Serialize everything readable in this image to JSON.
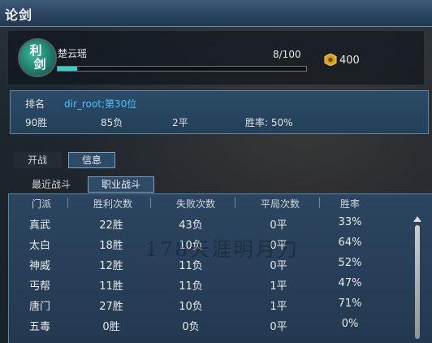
{
  "window": {
    "title": "论剑"
  },
  "player": {
    "emblem_top": "利",
    "emblem_bottom": "剑",
    "name": "楚云瑶",
    "progress_text": "8/100",
    "progress_fraction": 0.08,
    "currency": "400"
  },
  "stats": {
    "rank_label": "排名",
    "rank_value": "dir_root;第30位",
    "wins": "90胜",
    "losses": "85负",
    "draws": "2平",
    "win_rate": "胜率:  50%"
  },
  "tabs": {
    "main": [
      "开战",
      "信息"
    ],
    "sub": [
      "最近战斗",
      "职业战斗"
    ]
  },
  "table": {
    "headers": [
      "门派",
      "胜利次数",
      "失败次数",
      "平局次数",
      "胜率"
    ],
    "rows": [
      [
        "真武",
        "22胜",
        "43负",
        "0平",
        "33%"
      ],
      [
        "太白",
        "18胜",
        "10负",
        "0平",
        "64%"
      ],
      [
        "神威",
        "12胜",
        "11负",
        "0平",
        "52%"
      ],
      [
        "丐帮",
        "11胜",
        "11负",
        "1平",
        "47%"
      ],
      [
        "唐门",
        "27胜",
        "10负",
        "1平",
        "71%"
      ],
      [
        "五毒",
        "0胜",
        "0负",
        "0平",
        "0%"
      ]
    ]
  },
  "watermark": "178天涯明月刀",
  "colors": {
    "accent": "#4cc2ff",
    "progress": "#3ad0c8",
    "panel": "#2c4b68"
  },
  "icons": {
    "currency": "gold-coin-icon",
    "scroll": "scroll-up-icon"
  }
}
